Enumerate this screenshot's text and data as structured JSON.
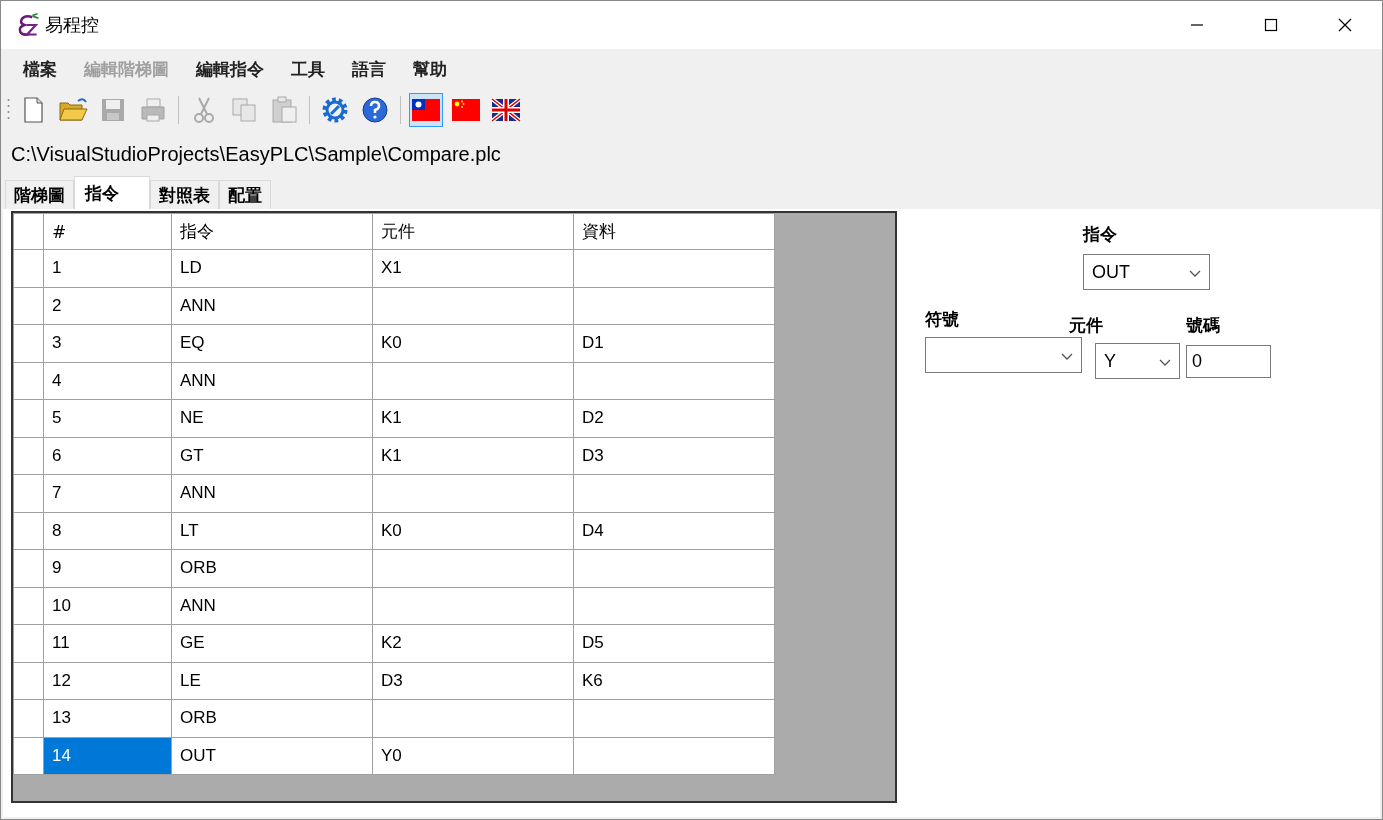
{
  "window": {
    "title": "易程控"
  },
  "menu": [
    {
      "label": "檔案",
      "disabled": false
    },
    {
      "label": "編輯階梯圖",
      "disabled": true
    },
    {
      "label": "編輯指令",
      "disabled": false
    },
    {
      "label": "工具",
      "disabled": false
    },
    {
      "label": "語言",
      "disabled": false
    },
    {
      "label": "幫助",
      "disabled": false
    }
  ],
  "toolbar": [
    {
      "kind": "new",
      "disabled": false
    },
    {
      "kind": "open",
      "disabled": false
    },
    {
      "kind": "save",
      "disabled": true
    },
    {
      "kind": "print",
      "disabled": true
    },
    {
      "kind": "separator"
    },
    {
      "kind": "cut",
      "disabled": true
    },
    {
      "kind": "copy",
      "disabled": true
    },
    {
      "kind": "paste",
      "disabled": true
    },
    {
      "kind": "separator"
    },
    {
      "kind": "settings",
      "disabled": false
    },
    {
      "kind": "help",
      "disabled": false
    },
    {
      "kind": "separator"
    },
    {
      "kind": "flag-tw",
      "selected": true
    },
    {
      "kind": "flag-cn",
      "selected": false
    },
    {
      "kind": "flag-uk",
      "selected": false
    }
  ],
  "file_path": "C:\\VisualStudioProjects\\EasyPLC\\Sample\\Compare.plc",
  "tabs": [
    {
      "label": "階梯圖",
      "selected": false
    },
    {
      "label": "指令",
      "selected": true
    },
    {
      "label": "對照表",
      "selected": false
    },
    {
      "label": "配置",
      "selected": false
    }
  ],
  "table": {
    "columns": [
      "#",
      "指令",
      "元件",
      "資料"
    ],
    "rows": [
      {
        "cells": [
          "1",
          "LD",
          "X1",
          ""
        ],
        "selected": false
      },
      {
        "cells": [
          "2",
          "ANN",
          "",
          ""
        ],
        "selected": false
      },
      {
        "cells": [
          "3",
          "EQ",
          "K0",
          "D1"
        ],
        "selected": false
      },
      {
        "cells": [
          "4",
          "ANN",
          "",
          ""
        ],
        "selected": false
      },
      {
        "cells": [
          "5",
          "NE",
          "K1",
          "D2"
        ],
        "selected": false
      },
      {
        "cells": [
          "6",
          "GT",
          "K1",
          "D3"
        ],
        "selected": false
      },
      {
        "cells": [
          "7",
          "ANN",
          "",
          ""
        ],
        "selected": false
      },
      {
        "cells": [
          "8",
          "LT",
          "K0",
          "D4"
        ],
        "selected": false
      },
      {
        "cells": [
          "9",
          "ORB",
          "",
          ""
        ],
        "selected": false
      },
      {
        "cells": [
          "10",
          "ANN",
          "",
          ""
        ],
        "selected": false
      },
      {
        "cells": [
          "11",
          "GE",
          "K2",
          "D5"
        ],
        "selected": false
      },
      {
        "cells": [
          "12",
          "LE",
          "D3",
          "K6"
        ],
        "selected": false
      },
      {
        "cells": [
          "13",
          "ORB",
          "",
          ""
        ],
        "selected": false
      },
      {
        "cells": [
          "14",
          "OUT",
          "Y0",
          ""
        ],
        "selected": true
      }
    ]
  },
  "editor": {
    "instruction": {
      "label": "指令",
      "value": "OUT"
    },
    "symbol": {
      "label": "符號"
    },
    "element": {
      "label": "元件",
      "value": "Y"
    },
    "number": {
      "label": "號碼",
      "value": "0"
    }
  }
}
